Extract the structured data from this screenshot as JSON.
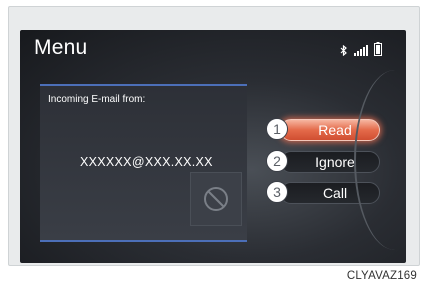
{
  "screen": {
    "title": "Menu",
    "status_icons": [
      "bluetooth-icon",
      "signal-strength-icon",
      "battery-icon"
    ]
  },
  "message_panel": {
    "header": "Incoming E-mail from:",
    "sender": "XXXXXX@XXX.XX.XX",
    "icon": "no-entry-icon"
  },
  "actions": [
    {
      "number": "1",
      "label": "Read",
      "highlighted": true
    },
    {
      "number": "2",
      "label": "Ignore",
      "highlighted": false
    },
    {
      "number": "3",
      "label": "Call",
      "highlighted": false
    }
  ],
  "caption": "CLYAVAZ169",
  "colors": {
    "accent_panel": "#4c6fb8",
    "highlight": "#e46a4a"
  }
}
